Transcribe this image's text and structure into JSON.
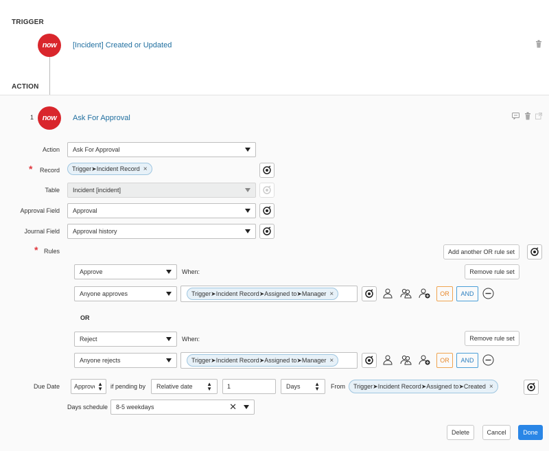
{
  "trigger": {
    "section_label": "TRIGGER",
    "badge": "now",
    "title": "[Incident] Created or Updated",
    "delete_icon": "trash-icon"
  },
  "action_section": {
    "section_label": "ACTION"
  },
  "action": {
    "index": "1",
    "badge": "now",
    "title": "Ask For Approval",
    "header_icons": [
      "comment-icon",
      "trash-icon",
      "open-external-icon"
    ]
  },
  "form": {
    "action": {
      "label": "Action",
      "value": "Ask For Approval"
    },
    "record": {
      "label": "Record",
      "pill": "Trigger➤Incident Record"
    },
    "table": {
      "label": "Table",
      "value": "Incident [incident]"
    },
    "approval_field": {
      "label": "Approval Field",
      "value": "Approval"
    },
    "journal_field": {
      "label": "Journal Field",
      "value": "Approval history"
    },
    "rules": {
      "label": "Rules",
      "add_or_rule_set": "Add another OR rule set"
    }
  },
  "rule_sets": [
    {
      "decision": "Approve",
      "when_label": "When:",
      "remove_label": "Remove rule set",
      "condition": "Anyone approves",
      "pill": "Trigger➤Incident Record➤Assigned to➤Manager",
      "or_label": "OR",
      "and_label": "AND"
    },
    {
      "decision": "Reject",
      "when_label": "When:",
      "remove_label": "Remove rule set",
      "condition": "Anyone rejects",
      "pill": "Trigger➤Incident Record➤Assigned to➤Manager",
      "or_label": "OR",
      "and_label": "AND"
    }
  ],
  "or_separator": "OR",
  "due_date": {
    "label": "Due Date",
    "decision": "Approve",
    "if_pending_label": "if pending by",
    "pending_type": "Relative date",
    "amount": "1",
    "unit": "Days",
    "from_label": "From",
    "from_pill": "Trigger➤Incident Record➤Assigned to➤Created",
    "schedule_label": "Days schedule",
    "schedule_value": "8-5 weekdays"
  },
  "footer": {
    "delete": "Delete",
    "cancel": "Cancel",
    "done": "Done"
  },
  "colors": {
    "brand_red": "#d9262c",
    "link": "#1f6e9f",
    "primary": "#2a86e6",
    "or": "#e8882a",
    "and": "#2b7fc0"
  }
}
